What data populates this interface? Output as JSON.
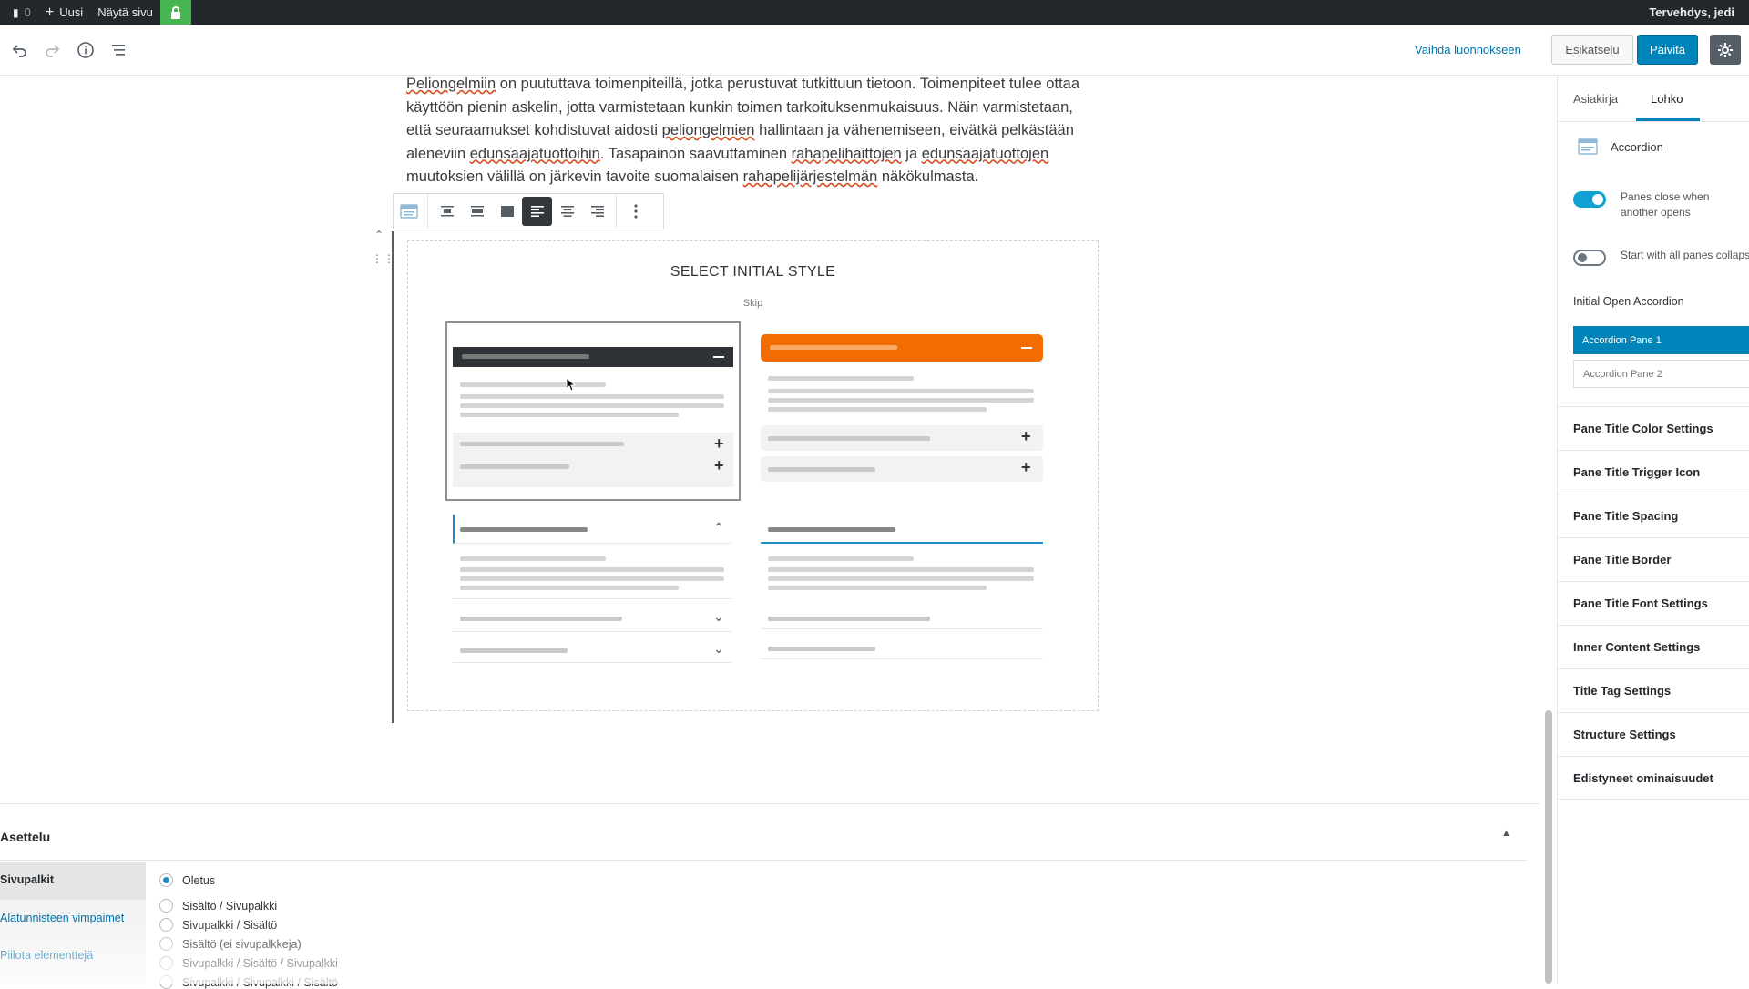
{
  "adminbar": {
    "comments_count": "0",
    "new_label": "Uusi",
    "view_label": "Näytä sivu",
    "greeting": "Tervehdys, jedi"
  },
  "header": {
    "switch_to_draft": "Vaihda luonnokseen",
    "preview": "Esikatselu",
    "update": "Päivitä"
  },
  "content": {
    "paragraph_segments": [
      {
        "t": "Peliongelmiin",
        "u": true
      },
      {
        "t": " on puututtava toimenpiteillä, jotka perustuvat tutkittuun tietoon. Toimenpiteet tulee ottaa käyttöön pienin askelin, jotta varmistetaan kunkin toimen tarkoituksenmukaisuus. Näin varmistetaan, että seuraamukset kohdistuvat aidosti ",
        "u": false
      },
      {
        "t": "peliongelmien",
        "u": true
      },
      {
        "t": " hallintaan ja vähenemiseen, eivätkä pelkästään aleneviin ",
        "u": false
      },
      {
        "t": "edunsaajatuottoihin",
        "u": true
      },
      {
        "t": ". Tasapainon saavuttaminen ",
        "u": false
      },
      {
        "t": "rahapelihaittojen",
        "u": true
      },
      {
        "t": " ja ",
        "u": false
      },
      {
        "t": "edunsaajatuottojen",
        "u": true
      },
      {
        "t": " muutoksien välillä on järkevin tavoite suomalaisen ",
        "u": false
      },
      {
        "t": "rahapelijärjestelmän",
        "u": true
      },
      {
        "t": " näkökulmasta.",
        "u": false
      }
    ],
    "placeholder_title": "SELECT INITIAL STYLE",
    "placeholder_skip": "Skip",
    "accent_orange": "#f26d00",
    "accent_blue": "#1e8cbe"
  },
  "sidebar": {
    "tabs": [
      "Asiakirja",
      "Lohko"
    ],
    "block_name": "Accordion",
    "toggles": [
      {
        "label": "Panes close when another opens",
        "on": true
      },
      {
        "label": "Start with all panes collapsed",
        "on": false
      }
    ],
    "initial_open_label": "Initial Open Accordion",
    "pane_options": [
      "Accordion Pane 1",
      "Accordion Pane 2"
    ],
    "panels": [
      "Pane Title Color Settings",
      "Pane Title Trigger Icon",
      "Pane Title Spacing",
      "Pane Title Border",
      "Pane Title Font Settings",
      "Inner Content Settings",
      "Title Tag Settings",
      "Structure Settings",
      "Edistyneet ominaisuudet"
    ]
  },
  "metabox": {
    "title": "Asettelu",
    "tabs": [
      "Sivupalkit",
      "Alatunnisteen vimpaimet",
      "Piilota elementtejä"
    ],
    "options": [
      {
        "label": "Oletus",
        "checked": true
      },
      {
        "label": "Sisältö / Sivupalkki",
        "checked": false
      },
      {
        "label": "Sivupalkki / Sisältö",
        "checked": false
      },
      {
        "label": "Sisältö (ei sivupalkkeja)",
        "checked": false
      },
      {
        "label": "Sivupalkki / Sisältö / Sivupalkki",
        "checked": false
      },
      {
        "label": "Sivupalkki / Sivupalkki / Sisältö",
        "checked": false
      }
    ]
  }
}
